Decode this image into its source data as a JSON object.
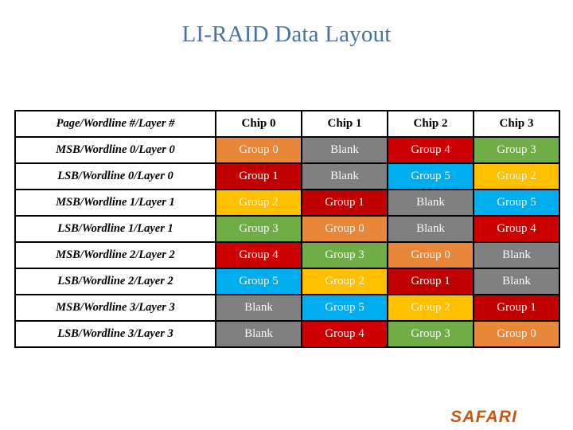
{
  "slide": {
    "title": "LI-RAID Data Layout",
    "title_color": "#4472A8",
    "background": "#FFFFFF",
    "logo": "SAFARI",
    "logo_color": "#C35A13"
  },
  "table": {
    "columns": [
      "Page/Wordline #/Layer #",
      "Chip 0",
      "Chip 1",
      "Chip 2",
      "Chip 3"
    ],
    "rows": [
      {
        "label": "MSB/Wordline 0/Layer 0",
        "cells": [
          "Group 0",
          "Blank",
          "Group 4",
          "Group 3"
        ]
      },
      {
        "label": "LSB/Wordline 0/Layer 0",
        "cells": [
          "Group 1",
          "Blank",
          "Group 5",
          "Group 2"
        ]
      },
      {
        "label": "MSB/Wordline 1/Layer 1",
        "cells": [
          "Group 2",
          "Group 1",
          "Blank",
          "Group 5"
        ]
      },
      {
        "label": "LSB/Wordline 1/Layer 1",
        "cells": [
          "Group 3",
          "Group 0",
          "Blank",
          "Group 4"
        ]
      },
      {
        "label": "MSB/Wordline 2/Layer 2",
        "cells": [
          "Group 4",
          "Group 3",
          "Group 0",
          "Blank"
        ]
      },
      {
        "label": "LSB/Wordline 2/Layer 2",
        "cells": [
          "Group 5",
          "Group 2",
          "Group 1",
          "Blank"
        ]
      },
      {
        "label": "MSB/Wordline 3/Layer 3",
        "cells": [
          "Blank",
          "Group 5",
          "Group 2",
          "Group 1"
        ]
      },
      {
        "label": "LSB/Wordline 3/Layer 3",
        "cells": [
          "Blank",
          "Group 4",
          "Group 3",
          "Group 0"
        ]
      }
    ],
    "cell_colors": {
      "Group 0": "#E8873A",
      "Group 1": "#C00000",
      "Group 2": "#FFC000",
      "Group 3": "#70AD47",
      "Group 4": "#CC0000",
      "Group 5": "#00AEEF",
      "Blank": "#808080"
    }
  }
}
